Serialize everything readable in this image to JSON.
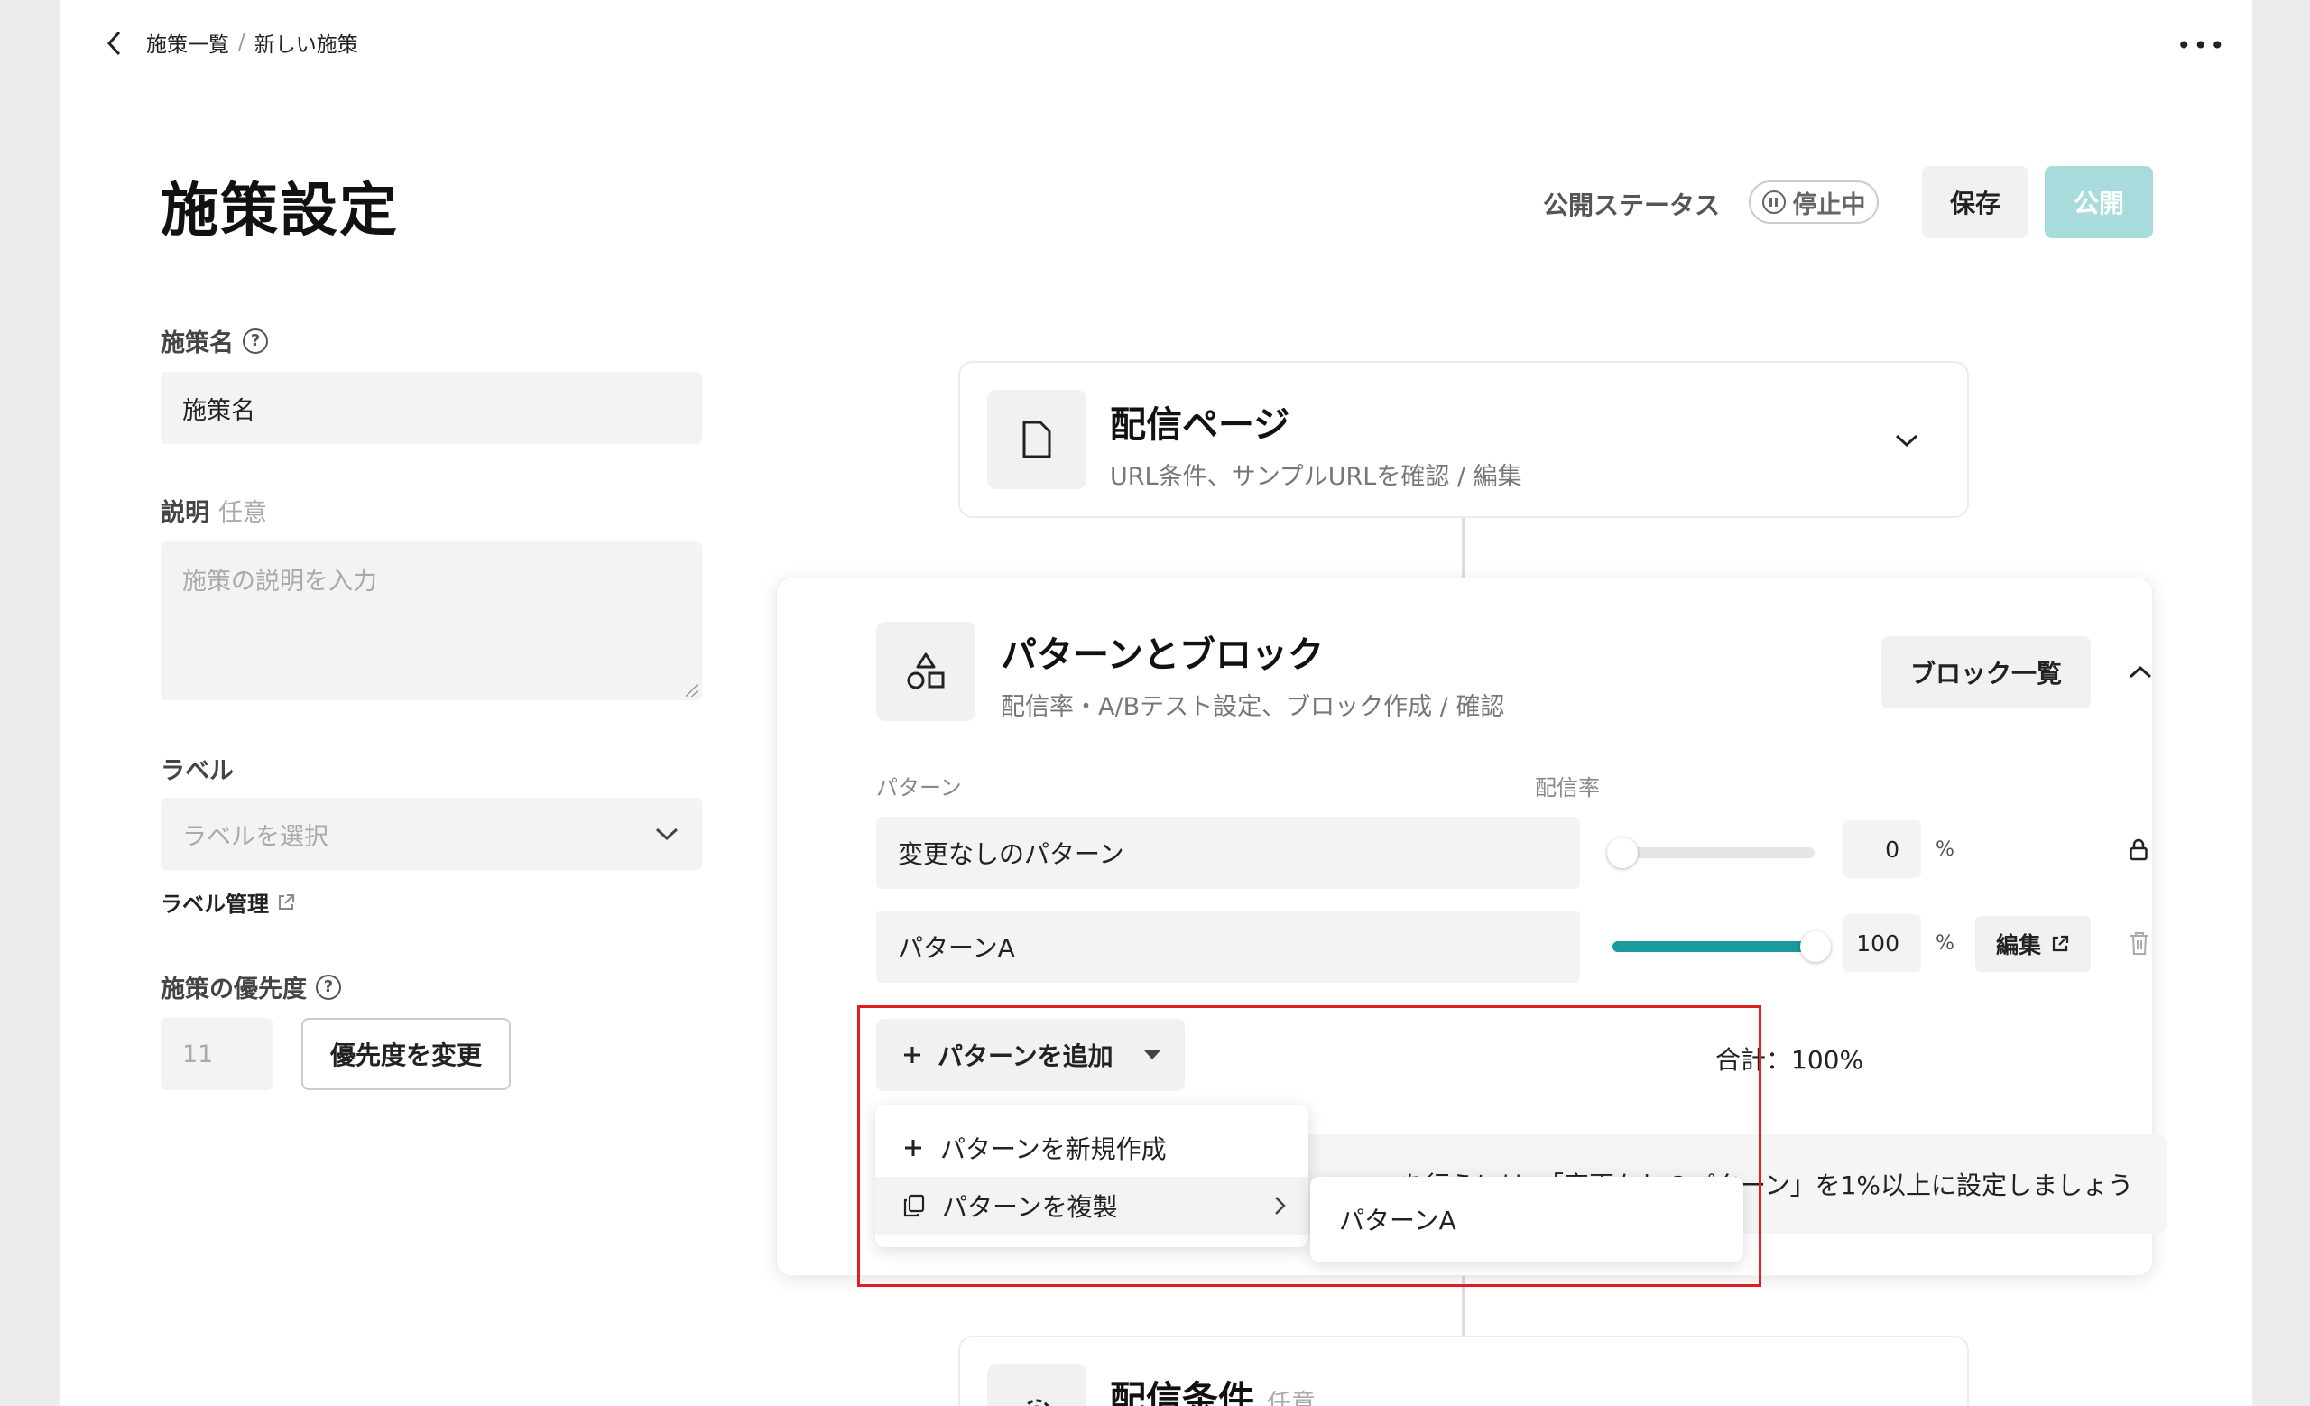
{
  "breadcrumb": {
    "parent": "施策一覧",
    "separator": "/",
    "current": "新しい施策"
  },
  "header": {
    "title": "施策設定",
    "status_label": "公開ステータス",
    "status_value": "停止中",
    "save_label": "保存",
    "publish_label": "公開"
  },
  "form": {
    "name_label": "施策名",
    "name_value": "施策名",
    "description_label": "説明",
    "description_optional": "任意",
    "description_placeholder": "施策の説明を入力",
    "label_label": "ラベル",
    "label_placeholder": "ラベルを選択",
    "label_manage": "ラベル管理",
    "priority_label": "施策の優先度",
    "priority_value": "11",
    "priority_button": "優先度を変更"
  },
  "delivery_page": {
    "title": "配信ページ",
    "subtitle": "URL条件、サンプルURLを確認 / 編集"
  },
  "patterns_section": {
    "title": "パターンとブロック",
    "subtitle": "配信率・A/Bテスト設定、ブロック作成 / 確認",
    "block_list_button": "ブロック一覧",
    "col_pattern": "パターン",
    "col_rate": "配信率",
    "rows": [
      {
        "name": "変更なしのパターン",
        "rate": "0",
        "unit": "%",
        "locked": true
      },
      {
        "name": "パターンA",
        "rate": "100",
        "unit": "%",
        "edit_label": "編集"
      }
    ],
    "add_button": "パターンを追加",
    "total": "合計：100%",
    "info_text": "を行うには、「変更なしのパターン」を1%以上に設定しましょう"
  },
  "add_menu": {
    "items": [
      {
        "label": "パターンを新規作成",
        "icon": "plus-icon"
      },
      {
        "label": "パターンを複製",
        "icon": "copy-icon"
      }
    ],
    "submenu_items": [
      "パターンA"
    ]
  },
  "conditions_section": {
    "title": "配信条件",
    "optional": "任意"
  },
  "colors": {
    "accent": "#1a9a9a",
    "publish_disabled": "#a8dcdc",
    "highlight": "#e02020"
  }
}
